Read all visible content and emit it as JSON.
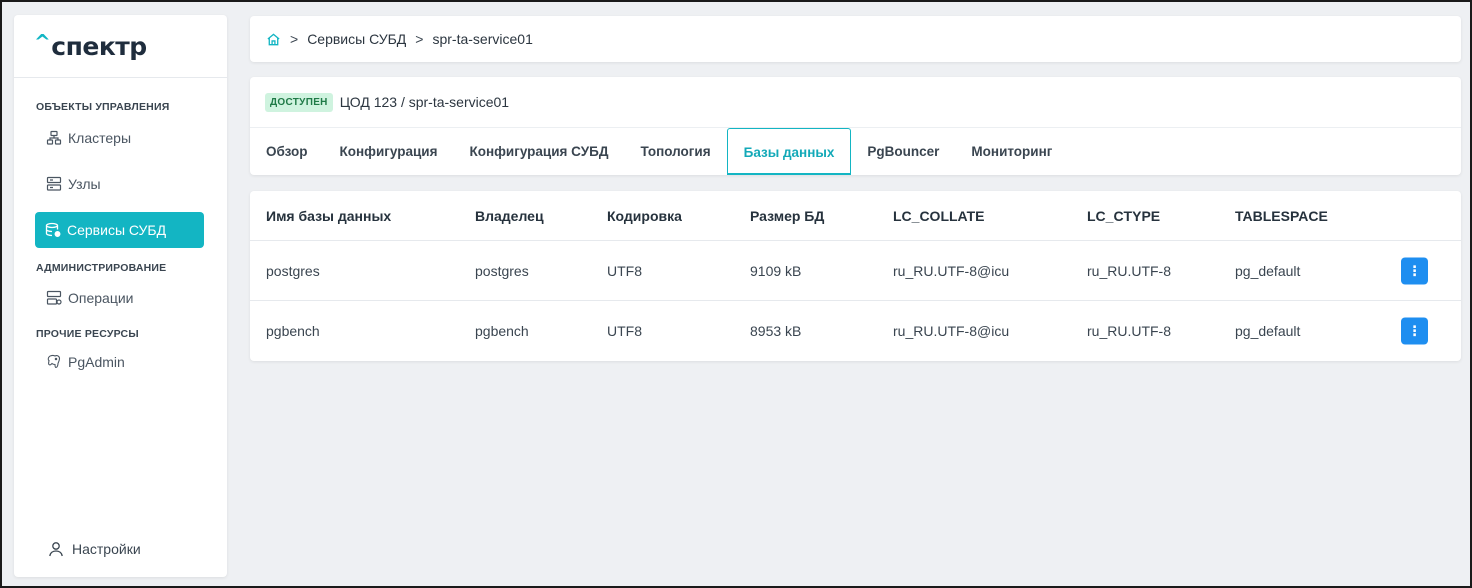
{
  "brand": {
    "caret": "^",
    "name": "спектр"
  },
  "sidebar": {
    "sections": [
      {
        "title": "ОБЪЕКТЫ УПРАВЛЕНИЯ"
      },
      {
        "title": "АДМИНИСТРИРОВАНИЕ"
      },
      {
        "title": "ПРОЧИЕ РЕСУРСЫ"
      }
    ],
    "items": [
      {
        "label": "Кластеры",
        "icon": "cluster-icon"
      },
      {
        "label": "Узлы",
        "icon": "nodes-icon"
      },
      {
        "label": "Сервисы СУБД",
        "icon": "db-services-icon",
        "active": true
      },
      {
        "label": "Операции",
        "icon": "operations-icon"
      },
      {
        "label": "PgAdmin",
        "icon": "pgadmin-icon"
      }
    ],
    "settings_label": "Настройки"
  },
  "breadcrumb": {
    "sep": ">",
    "items": [
      "Сервисы СУБД",
      "spr-ta-service01"
    ]
  },
  "header": {
    "status_badge": "ДОСТУПЕН",
    "path": "ЦОД 123 / spr-ta-service01"
  },
  "tabs": [
    {
      "label": "Обзор"
    },
    {
      "label": "Конфигурация"
    },
    {
      "label": "Конфигурация СУБД"
    },
    {
      "label": "Топология"
    },
    {
      "label": "Базы данных",
      "active": true
    },
    {
      "label": "PgBouncer"
    },
    {
      "label": "Мониторинг"
    }
  ],
  "table": {
    "columns": [
      "Имя базы данных",
      "Владелец",
      "Кодировка",
      "Размер БД",
      "LC_COLLATE",
      "LC_CTYPE",
      "TABLESPACE"
    ],
    "rows": [
      [
        "postgres",
        "postgres",
        "UTF8",
        "9109 kB",
        "ru_RU.UTF-8@icu",
        "ru_RU.UTF-8",
        "pg_default"
      ],
      [
        "pgbench",
        "pgbench",
        "UTF8",
        "8953 kB",
        "ru_RU.UTF-8@icu",
        "ru_RU.UTF-8",
        "pg_default"
      ]
    ],
    "row_action_label": "⋮"
  },
  "colors": {
    "accent": "#13b5c3",
    "action_button": "#1e8ef0",
    "badge_bg": "#cff3df",
    "badge_text": "#1f7a47"
  }
}
